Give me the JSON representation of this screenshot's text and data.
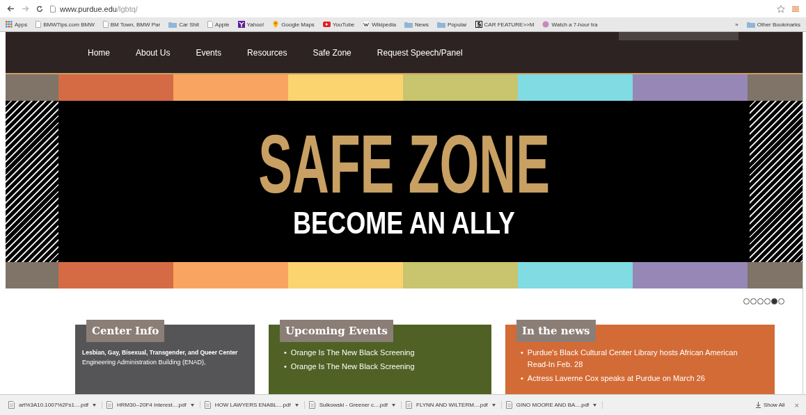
{
  "browser": {
    "url_host": "www.purdue.edu",
    "url_path": "/lgbtq/"
  },
  "bookmarks": [
    {
      "label": "Apps",
      "kind": "apps"
    },
    {
      "label": "BMWTips.com BMW",
      "kind": "page"
    },
    {
      "label": "BM Town, BMW Par",
      "kind": "page"
    },
    {
      "label": "Car Shit",
      "kind": "folder"
    },
    {
      "label": "Apple",
      "kind": "page"
    },
    {
      "label": "Yahoo!",
      "kind": "yahoo"
    },
    {
      "label": "Google Maps",
      "kind": "maps"
    },
    {
      "label": "YouTube",
      "kind": "youtube"
    },
    {
      "label": "Wikipedia",
      "kind": "wiki"
    },
    {
      "label": "News",
      "kind": "folder"
    },
    {
      "label": "Popular",
      "kind": "folder"
    },
    {
      "label": "CAR FEATURE>>M",
      "kind": "slogo"
    },
    {
      "label": "Watch a 7-hour tra",
      "kind": "circle"
    }
  ],
  "bookmarks_more": "»",
  "other_bookmarks": "Other Bookmarks",
  "nav": [
    {
      "label": "Home"
    },
    {
      "label": "About Us"
    },
    {
      "label": "Events"
    },
    {
      "label": "Resources"
    },
    {
      "label": "Safe Zone"
    },
    {
      "label": "Request Speech/Panel"
    }
  ],
  "banner": {
    "title": "SAFE ZONE",
    "subtitle": "BECOME AN ALLY",
    "stripes": [
      {
        "color": "#7f7467"
      },
      {
        "color": "#d46b45"
      },
      {
        "color": "#f9a561"
      },
      {
        "color": "#fcd46f"
      },
      {
        "color": "#c9c46e"
      },
      {
        "color": "#80dbe2"
      },
      {
        "color": "#9687b7"
      },
      {
        "color": "#7f7467"
      }
    ]
  },
  "slides": [
    {
      "selected": false
    },
    {
      "selected": false
    },
    {
      "selected": false
    },
    {
      "selected": false
    },
    {
      "selected": true
    },
    {
      "selected": false
    }
  ],
  "cards": [
    {
      "title": "Center Info",
      "kind": "info",
      "lines": [
        "Lesbian, Gay, Bisexual, Transgender, and Queer Center",
        "Engineering Administration Building (ENAD),"
      ]
    },
    {
      "title": "Upcoming Events",
      "kind": "list",
      "lines": [
        "Orange Is The New Black Screening",
        "Orange Is The New Black Screening"
      ]
    },
    {
      "title": "In the news",
      "kind": "list",
      "lines": [
        "Purdue's Black Cultural Center Library hosts African American Read-In Feb. 28",
        "Actress Laverne Cox speaks at Purdue on March 26"
      ]
    }
  ],
  "downloads": [
    {
      "name": "art%3A10.1007%2Fs1....pdf"
    },
    {
      "name": "HRM30--20F4 Interest....pdf"
    },
    {
      "name": "HOW LAWYERS ENABL....pdf"
    },
    {
      "name": "Sulkowski - Greener c....pdf"
    },
    {
      "name": "FLYNN AND WILTERM....pdf"
    },
    {
      "name": "GINO MOORE AND BA....pdf"
    }
  ],
  "bullet": "•",
  "show_all": "Show All",
  "close": "×"
}
